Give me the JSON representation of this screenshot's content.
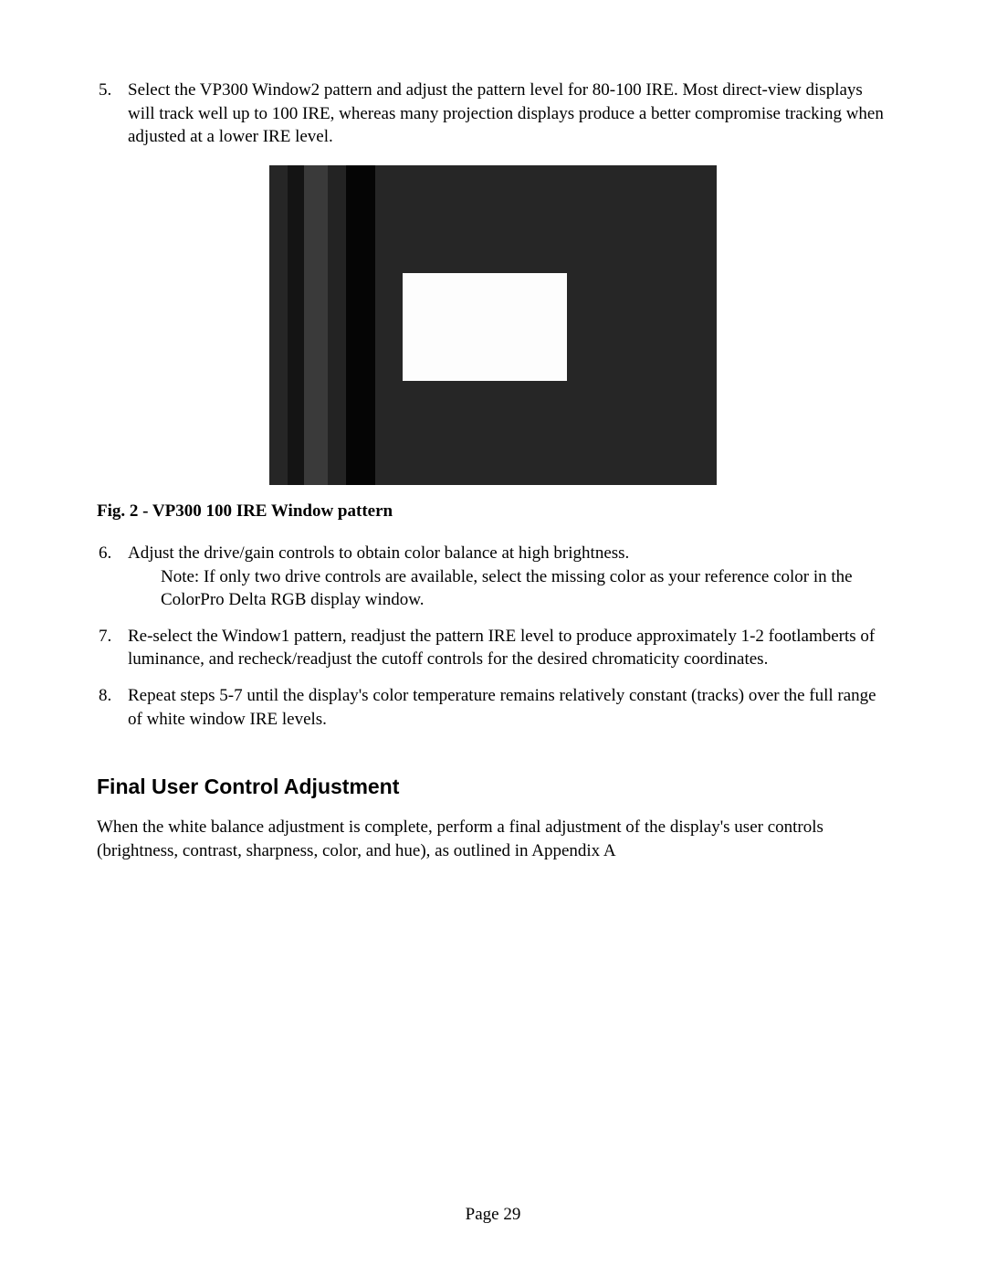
{
  "list": {
    "item5_num": "5.",
    "item5": "Select the VP300 Window2 pattern and adjust the pattern level for 80-100 IRE. Most direct-view displays will track well up to 100 IRE, whereas many projection displays produce a better compromise tracking when adjusted at a lower IRE level.",
    "item6_num": "6.",
    "item6_a": "Adjust the drive/gain controls to obtain color balance at high brightness.",
    "item6_b": "Note: If only two drive controls are available, select the missing color as your reference color in the ColorPro Delta RGB display window.",
    "item7_num": "7.",
    "item7": "Re-select the Window1 pattern, readjust the pattern IRE level to produce approximately 1-2 footlamberts of luminance, and recheck/readjust the cutoff controls for the desired chromaticity coordinates.",
    "item8_num": "8.",
    "item8": "Repeat steps 5-7 until the display's color temperature remains relatively constant (tracks) over the full range of white window IRE levels."
  },
  "figure_caption": "Fig. 2 - VP300  100 IRE Window pattern",
  "section_heading": "Final User Control Adjustment",
  "final_paragraph": "When the white balance adjustment is complete, perform a final adjustment of the display's user controls (brightness, contrast, sharpness, color, and hue), as outlined in Appendix A",
  "page_number": "Page 29"
}
